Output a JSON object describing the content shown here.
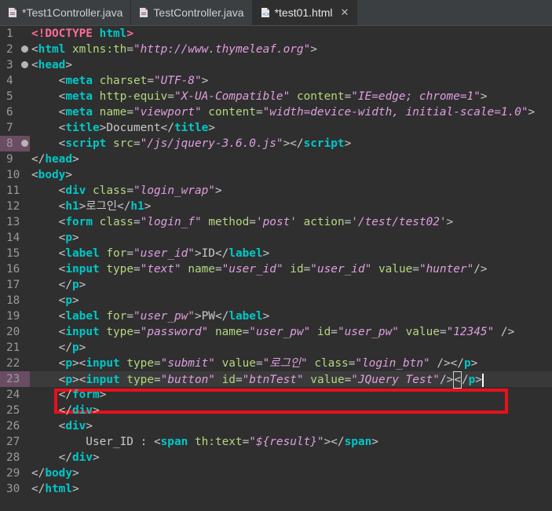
{
  "tabs": [
    {
      "label": "*Test1Controller.java",
      "icon": "java-file-icon",
      "active": false
    },
    {
      "label": "TestController.java",
      "icon": "java-file-icon",
      "active": false
    },
    {
      "label": "*test01.html",
      "icon": "html-file-icon",
      "active": true,
      "close": "✕"
    }
  ],
  "lines": [
    {
      "n": "1",
      "fold": false,
      "marked": false
    },
    {
      "n": "2",
      "fold": true,
      "marked": false
    },
    {
      "n": "3",
      "fold": true,
      "marked": false
    },
    {
      "n": "4",
      "fold": false,
      "marked": false
    },
    {
      "n": "5",
      "fold": false,
      "marked": false
    },
    {
      "n": "6",
      "fold": false,
      "marked": false
    },
    {
      "n": "7",
      "fold": false,
      "marked": false
    },
    {
      "n": "8",
      "fold": true,
      "marked": true
    },
    {
      "n": "9",
      "fold": false,
      "marked": false
    },
    {
      "n": "10",
      "fold": false,
      "marked": false
    },
    {
      "n": "11",
      "fold": false,
      "marked": false
    },
    {
      "n": "12",
      "fold": false,
      "marked": false
    },
    {
      "n": "13",
      "fold": false,
      "marked": false
    },
    {
      "n": "14",
      "fold": false,
      "marked": false
    },
    {
      "n": "15",
      "fold": false,
      "marked": false
    },
    {
      "n": "16",
      "fold": false,
      "marked": false
    },
    {
      "n": "17",
      "fold": false,
      "marked": false
    },
    {
      "n": "18",
      "fold": false,
      "marked": false
    },
    {
      "n": "19",
      "fold": false,
      "marked": false
    },
    {
      "n": "20",
      "fold": false,
      "marked": false
    },
    {
      "n": "21",
      "fold": false,
      "marked": false
    },
    {
      "n": "22",
      "fold": false,
      "marked": false
    },
    {
      "n": "23",
      "fold": false,
      "marked": true
    },
    {
      "n": "24",
      "fold": false,
      "marked": false
    },
    {
      "n": "25",
      "fold": false,
      "marked": false
    },
    {
      "n": "26",
      "fold": false,
      "marked": false
    },
    {
      "n": "27",
      "fold": false,
      "marked": false
    },
    {
      "n": "28",
      "fold": false,
      "marked": false
    },
    {
      "n": "29",
      "fold": false,
      "marked": false
    },
    {
      "n": "30",
      "fold": false,
      "marked": false
    }
  ],
  "code": [
    [
      [
        "kw",
        "<!DOCTYPE"
      ],
      [
        "p",
        " "
      ],
      [
        "t",
        "html"
      ],
      [
        "kw",
        ">"
      ]
    ],
    [
      [
        "p",
        "<"
      ],
      [
        "t",
        "html"
      ],
      [
        "p",
        " "
      ],
      [
        "a",
        "xmlns:th"
      ],
      [
        "p",
        "="
      ],
      [
        "v",
        "\"http://www.thymeleaf.org\""
      ],
      [
        "p",
        ">"
      ]
    ],
    [
      [
        "p",
        "<"
      ],
      [
        "t",
        "head"
      ],
      [
        "p",
        ">"
      ]
    ],
    [
      [
        "p",
        "    <"
      ],
      [
        "t",
        "meta"
      ],
      [
        "p",
        " "
      ],
      [
        "a",
        "charset"
      ],
      [
        "p",
        "="
      ],
      [
        "v",
        "\"UTF-8\""
      ],
      [
        "p",
        ">"
      ]
    ],
    [
      [
        "p",
        "    <"
      ],
      [
        "t",
        "meta"
      ],
      [
        "p",
        " "
      ],
      [
        "a",
        "http-equiv"
      ],
      [
        "p",
        "="
      ],
      [
        "v",
        "\"X-UA-Compatible\""
      ],
      [
        "p",
        " "
      ],
      [
        "a",
        "content"
      ],
      [
        "p",
        "="
      ],
      [
        "v",
        "\"IE=edge; chrome=1\""
      ],
      [
        "p",
        ">"
      ]
    ],
    [
      [
        "p",
        "    <"
      ],
      [
        "t",
        "meta"
      ],
      [
        "p",
        " "
      ],
      [
        "a",
        "name"
      ],
      [
        "p",
        "="
      ],
      [
        "v",
        "\"viewport\""
      ],
      [
        "p",
        " "
      ],
      [
        "a",
        "content"
      ],
      [
        "p",
        "="
      ],
      [
        "v",
        "\"width=device-width, initial-scale=1.0\""
      ],
      [
        "p",
        ">"
      ]
    ],
    [
      [
        "p",
        "    <"
      ],
      [
        "t",
        "title"
      ],
      [
        "p",
        ">Document</"
      ],
      [
        "t",
        "title"
      ],
      [
        "p",
        ">"
      ]
    ],
    [
      [
        "p",
        "    <"
      ],
      [
        "t",
        "script"
      ],
      [
        "p",
        " "
      ],
      [
        "a",
        "src"
      ],
      [
        "p",
        "="
      ],
      [
        "v",
        "\"/js/jquery-3.6.0.js\""
      ],
      [
        "p",
        "></"
      ],
      [
        "t",
        "script"
      ],
      [
        "p",
        ">"
      ]
    ],
    [
      [
        "p",
        "</"
      ],
      [
        "t",
        "head"
      ],
      [
        "p",
        ">"
      ]
    ],
    [
      [
        "p",
        "<"
      ],
      [
        "t",
        "body"
      ],
      [
        "p",
        ">"
      ]
    ],
    [
      [
        "p",
        "    <"
      ],
      [
        "t",
        "div"
      ],
      [
        "p",
        " "
      ],
      [
        "a",
        "class"
      ],
      [
        "p",
        "="
      ],
      [
        "v",
        "\"login_wrap\""
      ],
      [
        "p",
        ">"
      ]
    ],
    [
      [
        "p",
        "    <"
      ],
      [
        "t",
        "h1"
      ],
      [
        "p",
        ">로그인</"
      ],
      [
        "t",
        "h1"
      ],
      [
        "p",
        ">"
      ]
    ],
    [
      [
        "p",
        "    <"
      ],
      [
        "t",
        "form"
      ],
      [
        "p",
        " "
      ],
      [
        "a",
        "class"
      ],
      [
        "p",
        "="
      ],
      [
        "v",
        "\"login_f\""
      ],
      [
        "p",
        " "
      ],
      [
        "a",
        "method"
      ],
      [
        "p",
        "="
      ],
      [
        "v",
        "'post'"
      ],
      [
        "p",
        " "
      ],
      [
        "a",
        "action"
      ],
      [
        "p",
        "="
      ],
      [
        "v",
        "'/test/test02'"
      ],
      [
        "p",
        ">"
      ]
    ],
    [
      [
        "p",
        "    <"
      ],
      [
        "t",
        "p"
      ],
      [
        "p",
        ">"
      ]
    ],
    [
      [
        "p",
        "    <"
      ],
      [
        "t",
        "label"
      ],
      [
        "p",
        " "
      ],
      [
        "a",
        "for"
      ],
      [
        "p",
        "="
      ],
      [
        "v",
        "\"user_id\""
      ],
      [
        "p",
        ">ID</"
      ],
      [
        "t",
        "label"
      ],
      [
        "p",
        ">"
      ]
    ],
    [
      [
        "p",
        "    <"
      ],
      [
        "t",
        "input"
      ],
      [
        "p",
        " "
      ],
      [
        "a",
        "type"
      ],
      [
        "p",
        "="
      ],
      [
        "v",
        "\"text\""
      ],
      [
        "p",
        " "
      ],
      [
        "a",
        "name"
      ],
      [
        "p",
        "="
      ],
      [
        "v",
        "\"user_id\""
      ],
      [
        "p",
        " "
      ],
      [
        "a",
        "id"
      ],
      [
        "p",
        "="
      ],
      [
        "v",
        "\"user_id\""
      ],
      [
        "p",
        " "
      ],
      [
        "a",
        "value"
      ],
      [
        "p",
        "="
      ],
      [
        "v",
        "\"hunter\""
      ],
      [
        "p",
        "/>"
      ]
    ],
    [
      [
        "p",
        "    </"
      ],
      [
        "t",
        "p"
      ],
      [
        "p",
        ">"
      ]
    ],
    [
      [
        "p",
        "    <"
      ],
      [
        "t",
        "p"
      ],
      [
        "p",
        ">"
      ]
    ],
    [
      [
        "p",
        "    <"
      ],
      [
        "t",
        "label"
      ],
      [
        "p",
        " "
      ],
      [
        "a",
        "for"
      ],
      [
        "p",
        "="
      ],
      [
        "v",
        "\"user_pw\""
      ],
      [
        "p",
        ">PW</"
      ],
      [
        "t",
        "label"
      ],
      [
        "p",
        ">"
      ]
    ],
    [
      [
        "p",
        "    <"
      ],
      [
        "t",
        "input"
      ],
      [
        "p",
        " "
      ],
      [
        "a",
        "type"
      ],
      [
        "p",
        "="
      ],
      [
        "v",
        "\"password\""
      ],
      [
        "p",
        " "
      ],
      [
        "a",
        "name"
      ],
      [
        "p",
        "="
      ],
      [
        "v",
        "\"user_pw\""
      ],
      [
        "p",
        " "
      ],
      [
        "a",
        "id"
      ],
      [
        "p",
        "="
      ],
      [
        "v",
        "\"user_pw\""
      ],
      [
        "p",
        " "
      ],
      [
        "a",
        "value"
      ],
      [
        "p",
        "="
      ],
      [
        "v",
        "\"12345\""
      ],
      [
        "p",
        " />"
      ]
    ],
    [
      [
        "p",
        "    </"
      ],
      [
        "t",
        "p"
      ],
      [
        "p",
        ">"
      ]
    ],
    [
      [
        "p",
        "    <"
      ],
      [
        "t",
        "p"
      ],
      [
        "p",
        "><"
      ],
      [
        "t",
        "input"
      ],
      [
        "p",
        " "
      ],
      [
        "a",
        "type"
      ],
      [
        "p",
        "="
      ],
      [
        "v",
        "\"submit\""
      ],
      [
        "p",
        " "
      ],
      [
        "a",
        "value"
      ],
      [
        "p",
        "="
      ],
      [
        "v",
        "\"로그인\""
      ],
      [
        "p",
        " "
      ],
      [
        "a",
        "class"
      ],
      [
        "p",
        "="
      ],
      [
        "v",
        "\"login_btn\""
      ],
      [
        "p",
        " /></"
      ],
      [
        "t",
        "p"
      ],
      [
        "p",
        ">"
      ]
    ],
    [
      [
        "p",
        "    <"
      ],
      [
        "t",
        "p"
      ],
      [
        "p",
        "><"
      ],
      [
        "t",
        "input"
      ],
      [
        "p",
        " "
      ],
      [
        "a",
        "type"
      ],
      [
        "p",
        "="
      ],
      [
        "v",
        "\"button\""
      ],
      [
        "p",
        " "
      ],
      [
        "a",
        "id"
      ],
      [
        "p",
        "="
      ],
      [
        "v",
        "\"btnTest\""
      ],
      [
        "p",
        " "
      ],
      [
        "a",
        "value"
      ],
      [
        "p",
        "="
      ],
      [
        "v",
        "\"JQuery Test\""
      ],
      [
        "p",
        "/>"
      ],
      [
        "bm",
        "<"
      ],
      [
        "p",
        "/"
      ],
      [
        "t",
        "p"
      ],
      [
        "p",
        ">"
      ],
      [
        "caret",
        ""
      ]
    ],
    [
      [
        "p",
        "    </"
      ],
      [
        "t",
        "form"
      ],
      [
        "p",
        ">"
      ]
    ],
    [
      [
        "p",
        "    </"
      ],
      [
        "t",
        "div"
      ],
      [
        "p",
        ">"
      ]
    ],
    [
      [
        "p",
        "    <"
      ],
      [
        "t",
        "div"
      ],
      [
        "p",
        ">"
      ]
    ],
    [
      [
        "p",
        "        User_ID : <"
      ],
      [
        "t",
        "span"
      ],
      [
        "p",
        " "
      ],
      [
        "a",
        "th:text"
      ],
      [
        "p",
        "="
      ],
      [
        "v",
        "\"${result}\""
      ],
      [
        "p",
        "></"
      ],
      [
        "t",
        "span"
      ],
      [
        "p",
        ">"
      ]
    ],
    [
      [
        "p",
        "    </"
      ],
      [
        "t",
        "div"
      ],
      [
        "p",
        ">"
      ]
    ],
    [
      [
        "p",
        "</"
      ],
      [
        "t",
        "body"
      ],
      [
        "p",
        ">"
      ]
    ],
    [
      [
        "p",
        "</"
      ],
      [
        "t",
        "html"
      ],
      [
        "p",
        ">"
      ]
    ]
  ],
  "highlight_line": "23",
  "colors": {
    "highlight_box": "#e8101b",
    "tag": "#00c8c8",
    "attr": "#b5d77f",
    "value": "#e09ee0"
  }
}
